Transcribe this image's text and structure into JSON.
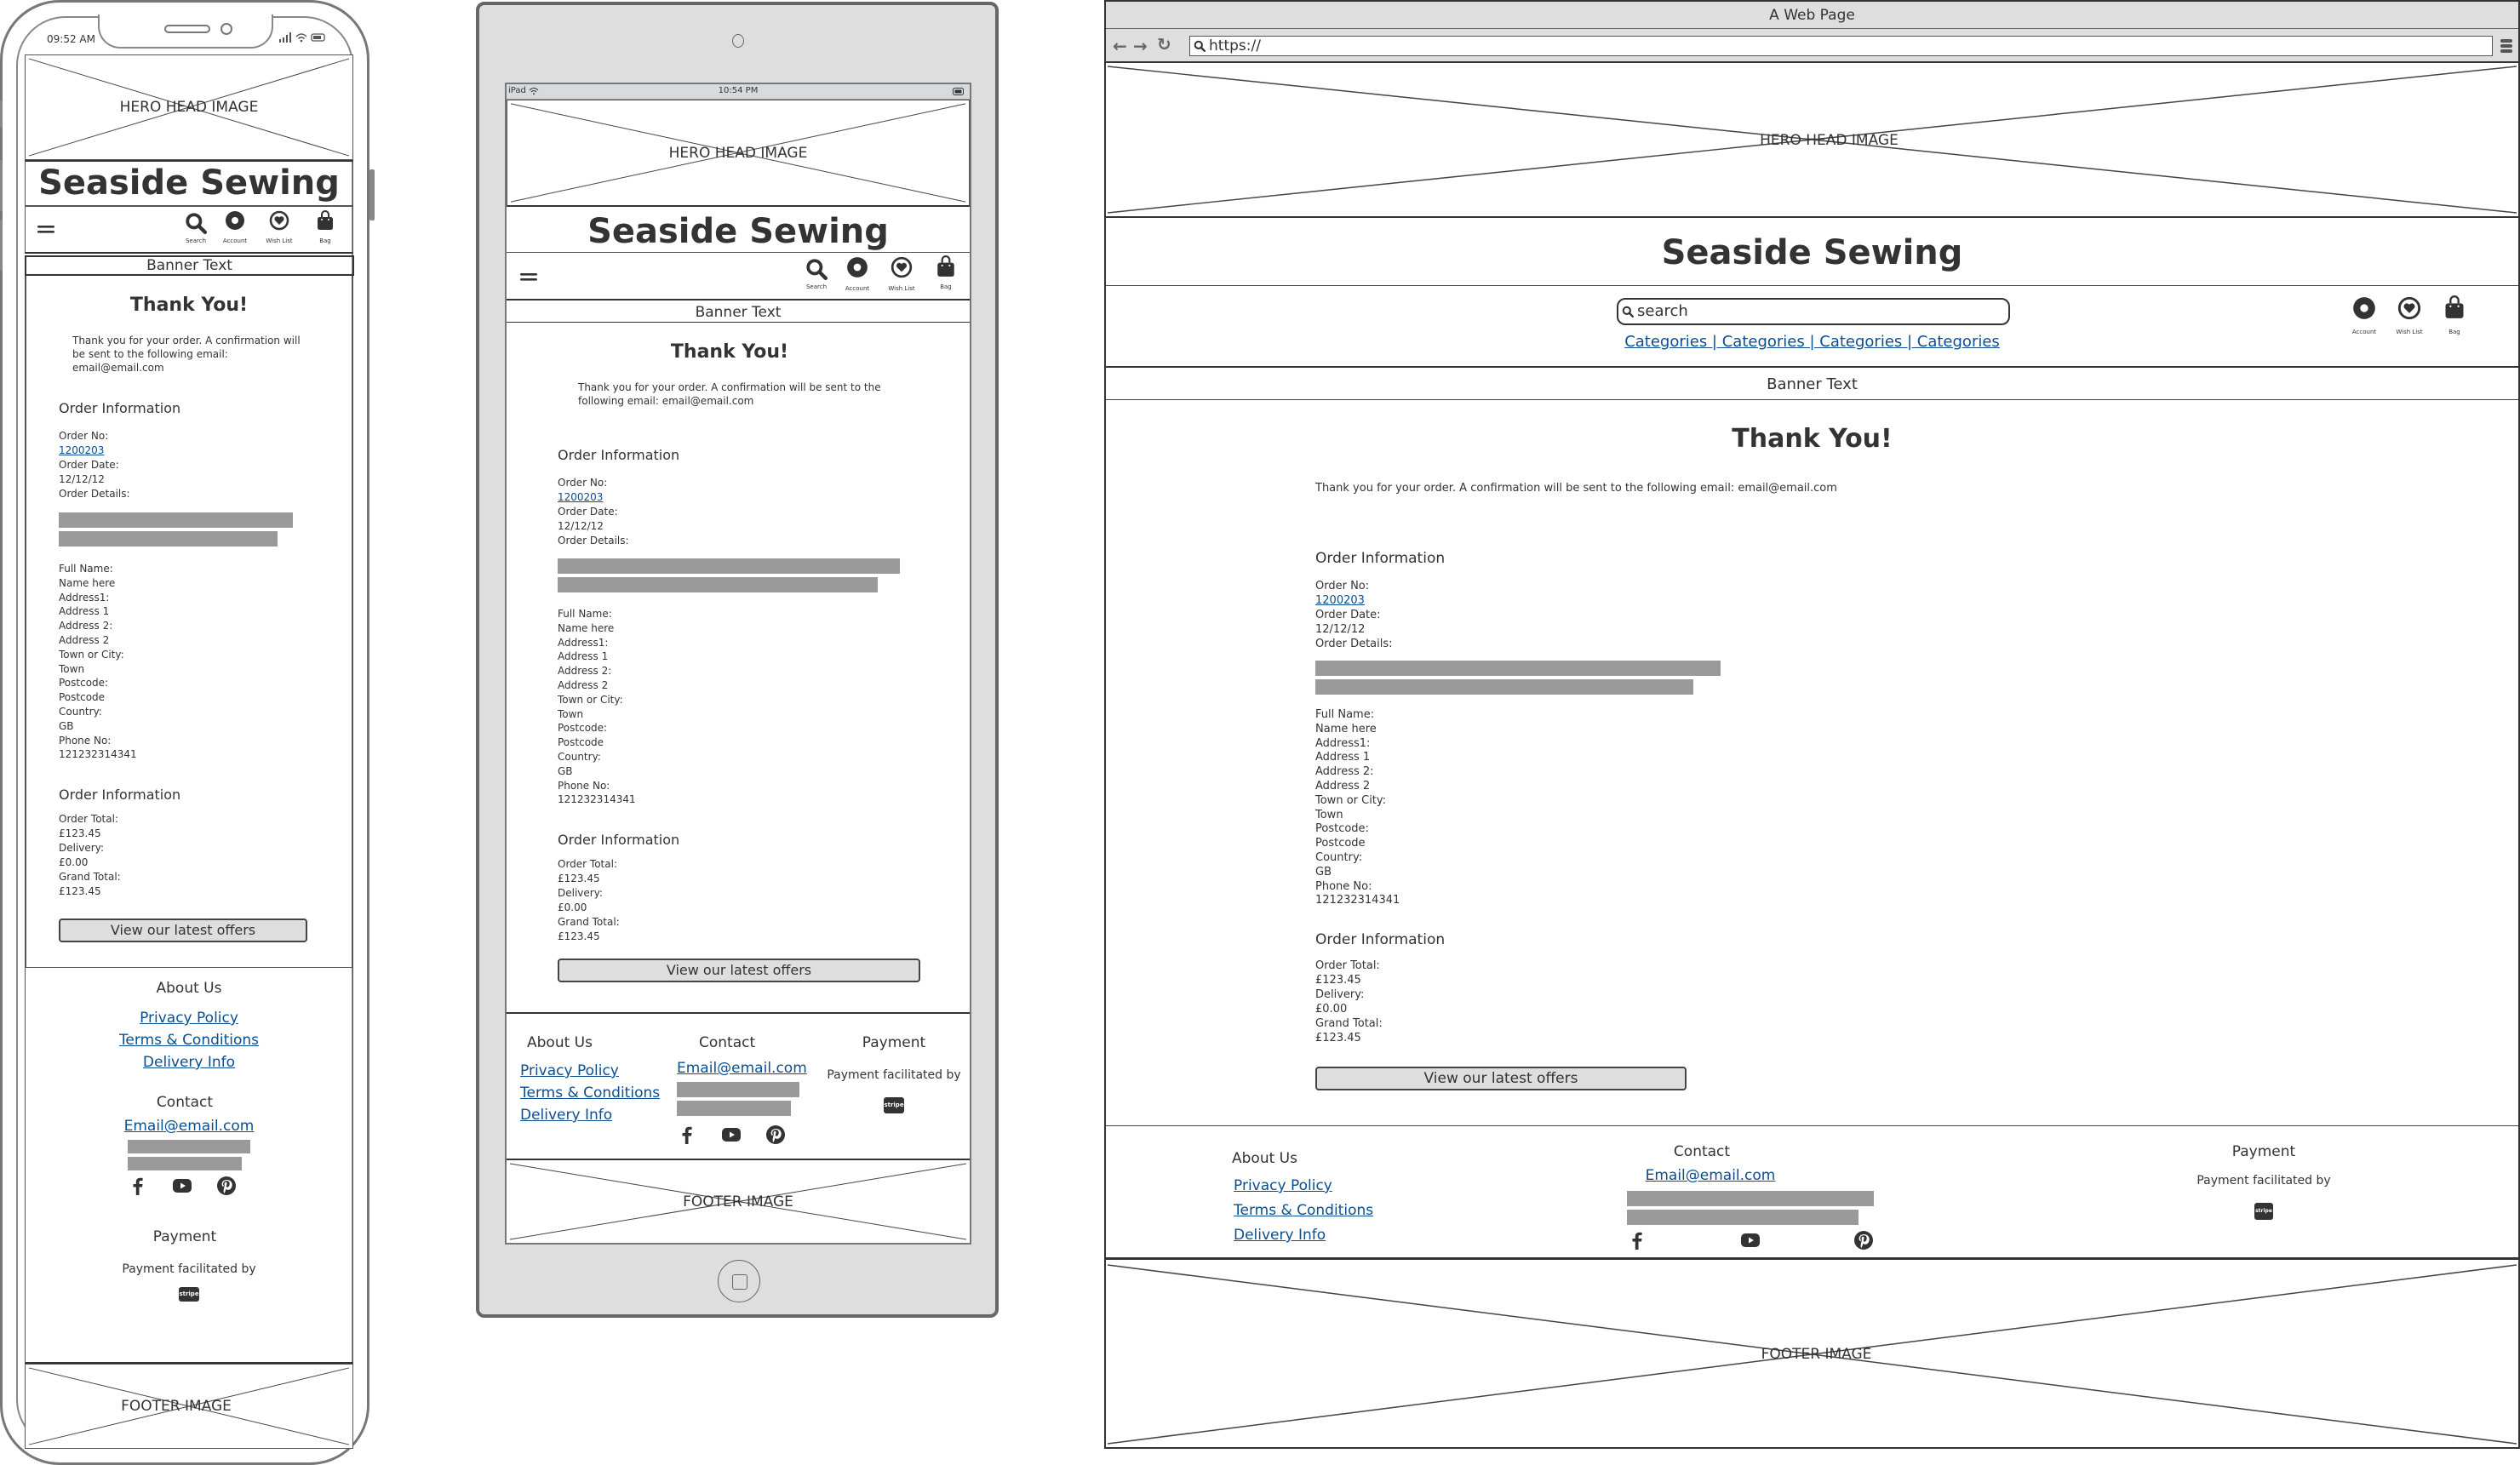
{
  "site": {
    "hero_label": "HERO HEAD IMAGE",
    "brand": "Seaside Sewing",
    "banner": "Banner Text",
    "footer_image_label": "FOOTER IMAGE",
    "nav_icons": [
      {
        "icon": "search-icon",
        "label": "Search"
      },
      {
        "icon": "account-icon",
        "label": "Account"
      },
      {
        "icon": "heart-icon",
        "label": "Wish List"
      },
      {
        "icon": "bag-icon",
        "label": "Bag"
      }
    ],
    "menu_icon": "hamburger-menu-icon"
  },
  "content": {
    "heading": "Thank You!",
    "message": "Thank you for your order.  A confirmation will be sent to the following email: email@email.com",
    "message_mobile_lines": [
      "Thank you for your order.  A confirmation will",
      "be sent to the following email:",
      "email@email.com"
    ],
    "message_tablet_lines": [
      "Thank you for your order.  A confirmation will be sent to the",
      "following email: email@email.com"
    ],
    "order_info_title": "Order Information",
    "order_no_label": "Order No:",
    "order_no": "1200203",
    "order_date_label": "Order Date:",
    "order_date": "12/12/12",
    "order_details_label": "Order Details:",
    "address_lines": [
      "Full Name:",
      "Name here",
      "Address1:",
      "Address 1",
      "Address 2:",
      "Address 2",
      "Town or City:",
      "Town",
      "Postcode:",
      "Postcode",
      "Country:",
      "GB",
      "Phone No:",
      "121232314341"
    ],
    "totals_title": "Order Information",
    "totals_lines": [
      "Order Total:",
      "£123.45",
      "Delivery:",
      "£0.00",
      "Grand Total:",
      "£123.45"
    ],
    "offers_button": "View our latest offers"
  },
  "footer": {
    "about_title": "About Us",
    "about_links": [
      "Privacy Policy",
      "Terms & Conditions",
      "Delivery Info"
    ],
    "contact_title": "Contact",
    "contact_email": "Email@email.com",
    "social": [
      "facebook-icon",
      "youtube-icon",
      "pinterest-icon"
    ],
    "payment_title": "Payment",
    "payment_text": "Payment facilitated by",
    "payment_badge": "stripe"
  },
  "phone": {
    "time": "09:52 AM"
  },
  "tablet": {
    "device": "iPad",
    "time": "10:54 PM"
  },
  "browser": {
    "title": "A Web Page",
    "url": "https://",
    "search_placeholder": "search",
    "categories": "Categories | Categories | Categories | Categories"
  }
}
